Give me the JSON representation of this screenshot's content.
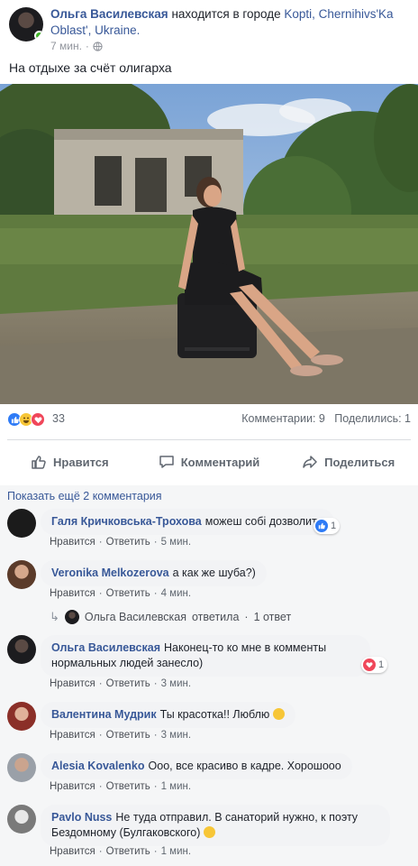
{
  "post": {
    "author": "Ольга Василевская",
    "location_prefix": "находится в городе",
    "location": "Kopti, Chernihivs'Ka Oblast', Ukraine.",
    "time": "7 мин.",
    "text": "На отдыхе за счёт олигарха"
  },
  "stats": {
    "reactions_count": "33",
    "comments": "Комментарии: 9",
    "shares": "Поделились: 1"
  },
  "actions": {
    "like": "Нравится",
    "comment": "Комментарий",
    "share": "Поделиться"
  },
  "show_more": "Показать ещё 2 комментария",
  "comment_like_label": "Нравится",
  "comment_reply_label": "Ответить",
  "comments": [
    {
      "name": "Галя Кричковська-Трохова",
      "text": "можеш собі дозволити",
      "time": "5 мин.",
      "reactions": "1"
    },
    {
      "name": "Veronika Melkozerova",
      "text": "а как же шуба?)",
      "time": "4 мин."
    },
    {
      "name": "Ольга Василевская",
      "text": "Наконец-то ко мне в комменты нормальных людей занесло)",
      "time": "3 мин.",
      "reactions": "1"
    },
    {
      "name": "Валентина Мудрик",
      "text": "Ты красотка!! Люблю",
      "time": "3 мин."
    },
    {
      "name": "Alesia Kovalenko",
      "text": "Ооо, все красиво в кадре. Хорошооо",
      "time": "1 мин."
    },
    {
      "name": "Pavlo Nuss",
      "text": "Не туда отправил. В санаторий нужно, к поэту Бездомному (Булгаковского)",
      "time": "1 мин."
    }
  ],
  "reply_summary": {
    "author": "Ольга Василевская",
    "verb": "ответила",
    "count": "1 ответ"
  }
}
